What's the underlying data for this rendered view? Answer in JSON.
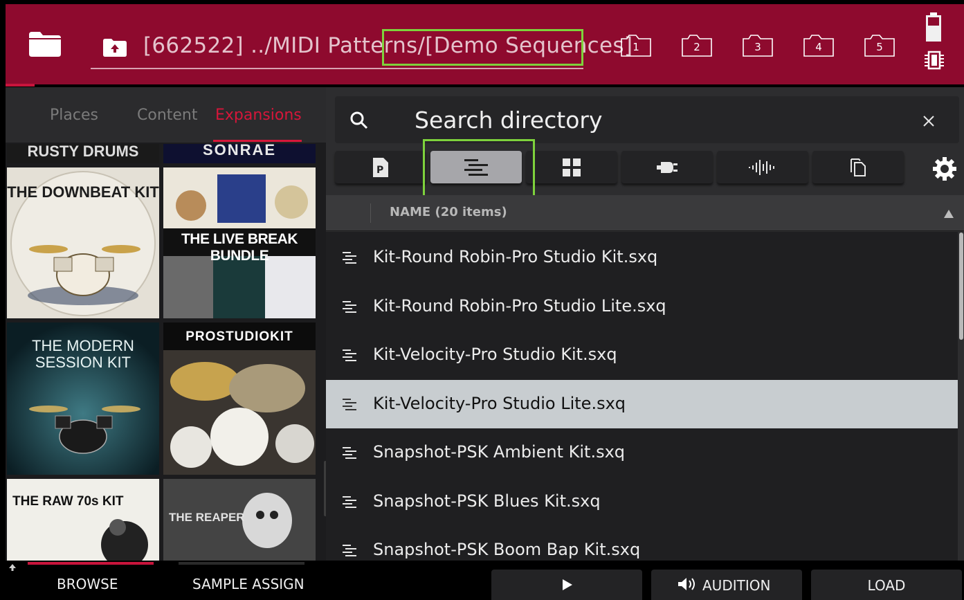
{
  "header": {
    "path_text": "[662522] ../MIDI Patterns/[Demo Sequences]",
    "recent_folders": [
      "1",
      "2",
      "3",
      "4",
      "5"
    ]
  },
  "left": {
    "tabs": [
      {
        "label": "Places",
        "active": false
      },
      {
        "label": "Content",
        "active": false
      },
      {
        "label": "Expansions",
        "active": true
      }
    ],
    "expansions": [
      {
        "title": "RUSTY DRUMS"
      },
      {
        "title": "SONRAE"
      },
      {
        "title": "THE DOWNBEAT KIT"
      },
      {
        "title": "THE LIVE BREAK BUNDLE"
      },
      {
        "title": "THE MODERN SESSION KIT"
      },
      {
        "title": "PROSTUDIOKIT"
      },
      {
        "title": "THE RAW 70s KIT"
      },
      {
        "title": "THE REAPER"
      }
    ]
  },
  "search": {
    "placeholder": "Search directory"
  },
  "filters": [
    {
      "icon": "program-icon",
      "active": false
    },
    {
      "icon": "sequence-icon",
      "active": true
    },
    {
      "icon": "grid-icon",
      "active": false
    },
    {
      "icon": "plugin-icon",
      "active": false
    },
    {
      "icon": "waveform-icon",
      "active": false
    },
    {
      "icon": "copy-icon",
      "active": false
    }
  ],
  "list": {
    "header": "NAME (20 items)",
    "sort": "ascending",
    "selected_index": 3,
    "items": [
      "Kit-Round Robin-Pro Studio Kit.sxq",
      "Kit-Round Robin-Pro Studio Lite.sxq",
      "Kit-Velocity-Pro Studio Kit.sxq",
      "Kit-Velocity-Pro Studio Lite.sxq",
      "Snapshot-PSK Ambient Kit.sxq",
      "Snapshot-PSK Blues Kit.sxq",
      "Snapshot-PSK Boom Bap Kit.sxq"
    ]
  },
  "bottom": {
    "modes": [
      {
        "label": "BROWSE",
        "active": true
      },
      {
        "label": "SAMPLE ASSIGN",
        "active": false
      }
    ],
    "actions": {
      "play_icon": "play-icon",
      "audition_label": "AUDITION",
      "load_label": "LOAD"
    }
  },
  "colors": {
    "header_bg": "#8e0a2e",
    "accent_red": "#d6163a",
    "highlight_green": "#7ed23c",
    "selected_row": "#c8cdd0"
  }
}
